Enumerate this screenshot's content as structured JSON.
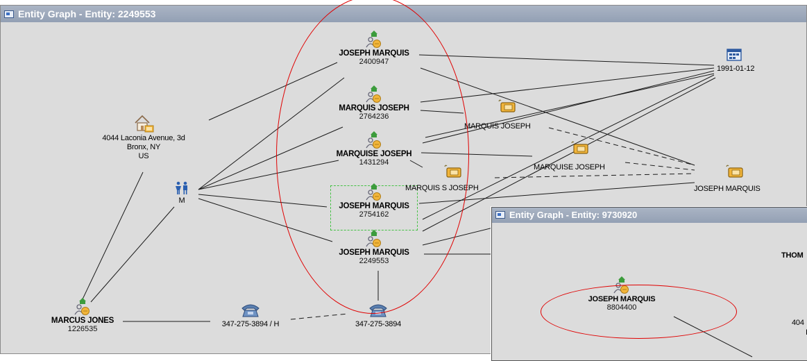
{
  "window_main": {
    "title": "Entity Graph - Entity: 2249553",
    "nodes": [
      {
        "name": "JOSEPH MARQUIS",
        "id": "2400947"
      },
      {
        "name": "MARQUIS JOSEPH",
        "id": "2764236"
      },
      {
        "name": "MARQUISE JOSEPH",
        "id": "1431294"
      },
      {
        "name": "JOSEPH MARQUIS",
        "id": "2754162"
      },
      {
        "name": "JOSEPH MARQUIS",
        "id": "2249553"
      }
    ],
    "address": {
      "line1": "4044 Laconia Avenue, 3d",
      "line2": "Bronx, NY",
      "line3": "US"
    },
    "gender": "M",
    "date": "1991-01-12",
    "aliases": [
      "MARQUIS JOSEPH",
      "MARQUISE JOSEPH",
      "MARQUIS S JOSEPH",
      "JOSEPH MARQUIS"
    ],
    "phones": [
      "347-275-3894 / H",
      "347-275-3894"
    ],
    "marcus": {
      "name": "MARCUS JONES",
      "id": "1226535"
    }
  },
  "window_second": {
    "title": "Entity Graph - Entity: 9730920",
    "node": {
      "name": "JOSEPH MARQUIS",
      "id": "8804400"
    },
    "partial_name": "THOM",
    "partial_text": "404",
    "partial_text2": "I"
  },
  "colors": {
    "annotation": "#e00000",
    "selection": "#43c143",
    "titlebar": "#9aa6b8",
    "background": "#dcdcdc"
  },
  "icons": [
    "person-entity-icon",
    "house-icon",
    "calendar-icon",
    "name-tag-icon",
    "gender-icon",
    "telephone-icon"
  ]
}
